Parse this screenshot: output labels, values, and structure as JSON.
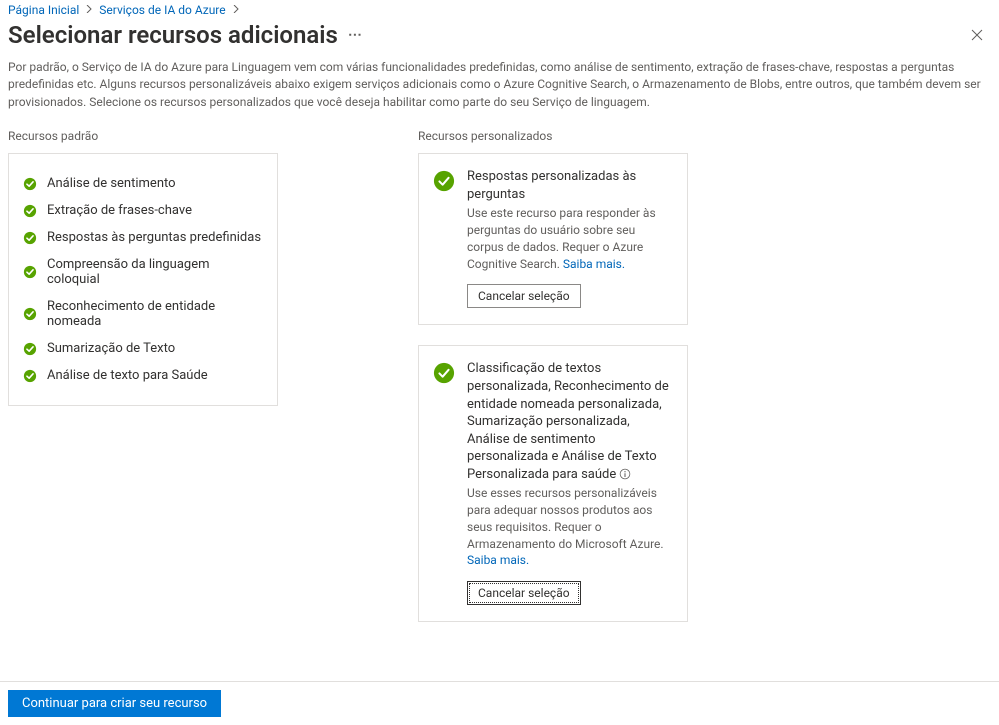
{
  "breadcrumb": {
    "home": "Página Inicial",
    "aiservices": "Serviços de IA do Azure"
  },
  "header": {
    "title": "Selecionar recursos adicionais"
  },
  "intro": "Por padrão, o Serviço de IA do Azure para Linguagem vem com várias funcionalidades predefinidas, como análise de sentimento, extração de frases-chave, respostas a perguntas predefinidas etc. Alguns recursos personalizáveis abaixo exigem serviços adicionais como o Azure Cognitive Search, o Armazenamento de Blobs, entre outros, que também devem ser provisionados. Selecione os recursos personalizados que você deseja habilitar como parte do seu Serviço de linguagem.",
  "sections": {
    "default_label": "Recursos padrão",
    "custom_label": "Recursos personalizados"
  },
  "defaults": [
    "Análise de sentimento",
    "Extração de frases-chave",
    "Respostas às perguntas predefinidas",
    "Compreensão da linguagem coloquial",
    "Reconhecimento de entidade nomeada",
    "Sumarização de Texto",
    "Análise de texto para Saúde"
  ],
  "custom": [
    {
      "title": "Respostas personalizadas às perguntas",
      "desc": "Use este recurso para responder às perguntas do usuário sobre seu corpus de dados. Requer o Azure Cognitive Search.",
      "learn": "Saiba mais.",
      "button": "Cancelar seleção",
      "has_info": false,
      "focused": false
    },
    {
      "title": "Classificação de textos personalizada, Reconhecimento de entidade nomeada personalizada, Sumarização personalizada, Análise de sentimento personalizada e Análise de Texto Personalizada para saúde",
      "desc": "Use esses recursos personalizáveis para adequar nossos produtos aos seus requisitos. Requer o Armazenamento do Microsoft Azure.",
      "learn": "Saiba mais.",
      "button": "Cancelar seleção",
      "has_info": true,
      "focused": true
    }
  ],
  "footer": {
    "primary": "Continuar para criar seu recurso"
  }
}
